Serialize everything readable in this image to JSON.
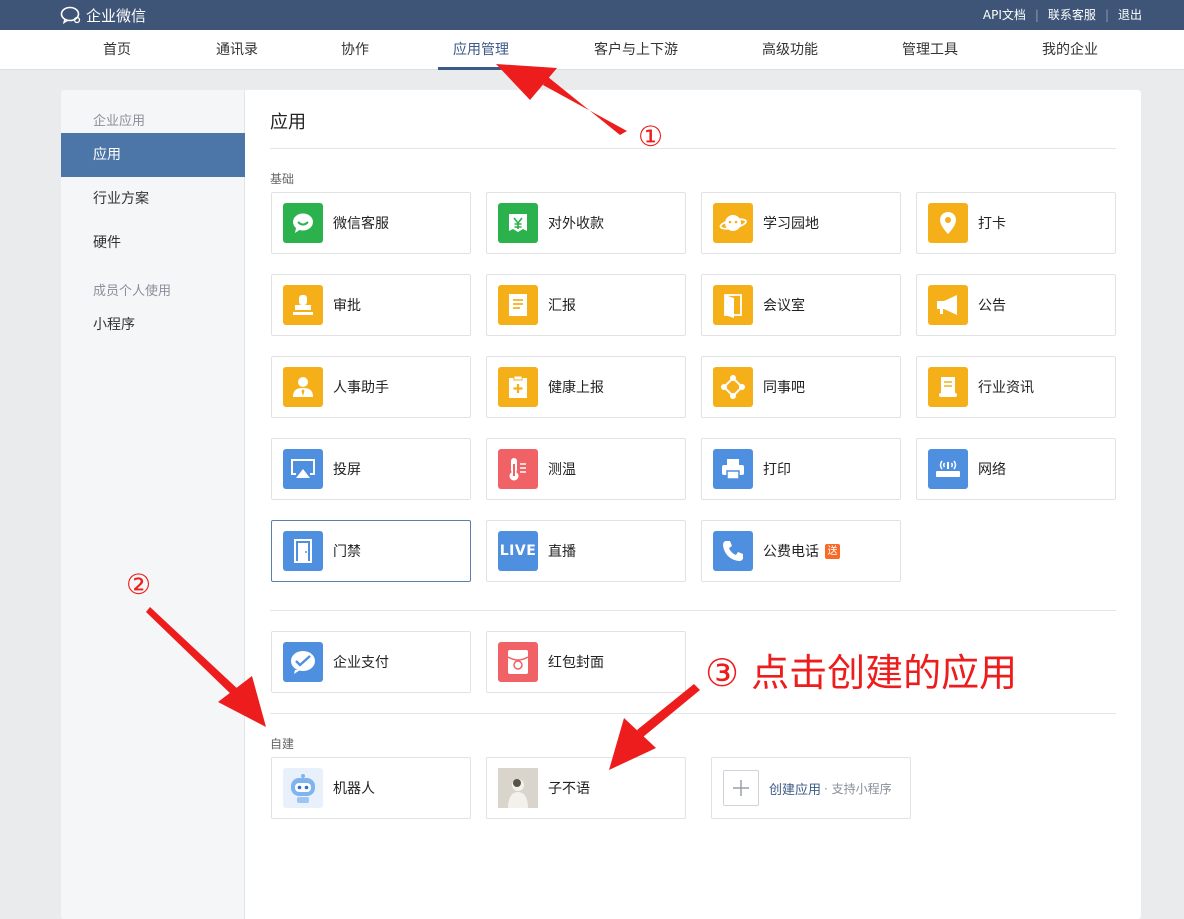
{
  "header": {
    "brand": "企业微信",
    "links": [
      "API文档",
      "联系客服",
      "退出"
    ]
  },
  "nav": {
    "items": [
      "首页",
      "通讯录",
      "协作",
      "应用管理",
      "客户与上下游",
      "高级功能",
      "管理工具",
      "我的企业"
    ],
    "active": "应用管理"
  },
  "sidebar": {
    "group1": "企业应用",
    "items1": [
      "应用",
      "行业方案",
      "硬件"
    ],
    "active": "应用",
    "group2": "成员个人使用",
    "items2": [
      "小程序"
    ]
  },
  "main": {
    "title": "应用",
    "section_basic": "基础",
    "basic_apps": [
      {
        "label": "微信客服",
        "icon": "chat-bubble-icon",
        "color": "#2bb24c"
      },
      {
        "label": "对外收款",
        "icon": "yuan-icon",
        "color": "#2bb24c"
      },
      {
        "label": "学习园地",
        "icon": "planet-icon",
        "color": "#f5b019"
      },
      {
        "label": "打卡",
        "icon": "location-pin-icon",
        "color": "#f5b019"
      },
      {
        "label": "审批",
        "icon": "stamp-icon",
        "color": "#f5b019"
      },
      {
        "label": "汇报",
        "icon": "report-doc-icon",
        "color": "#f5b019"
      },
      {
        "label": "会议室",
        "icon": "door-icon",
        "color": "#f5b019"
      },
      {
        "label": "公告",
        "icon": "megaphone-icon",
        "color": "#f5b019"
      },
      {
        "label": "人事助手",
        "icon": "person-icon",
        "color": "#f5b019"
      },
      {
        "label": "健康上报",
        "icon": "health-clipboard-icon",
        "color": "#f5b019"
      },
      {
        "label": "同事吧",
        "icon": "network-icon",
        "color": "#f5b019"
      },
      {
        "label": "行业资讯",
        "icon": "scroll-icon",
        "color": "#f5b019"
      },
      {
        "label": "投屏",
        "icon": "airplay-icon",
        "color": "#4f8fe0"
      },
      {
        "label": "测温",
        "icon": "thermometer-icon",
        "color": "#f06266"
      },
      {
        "label": "打印",
        "icon": "printer-icon",
        "color": "#4f8fe0"
      },
      {
        "label": "网络",
        "icon": "router-icon",
        "color": "#4f8fe0"
      },
      {
        "label": "门禁",
        "icon": "access-door-icon",
        "color": "#4f8fe0"
      },
      {
        "label": "直播",
        "icon": "live-icon",
        "color": "#4f8fe0"
      },
      {
        "label": "公费电话",
        "icon": "phone-icon",
        "color": "#4f8fe0",
        "badge": "送"
      }
    ],
    "pay_apps": [
      {
        "label": "企业支付",
        "icon": "wepay-icon",
        "color": "#4f8fe0"
      },
      {
        "label": "红包封面",
        "icon": "red-envelope-icon",
        "color": "#f06266"
      }
    ],
    "section_custom": "自建",
    "custom_apps": [
      {
        "label": "机器人",
        "icon": "robot-icon"
      },
      {
        "label": "子不语",
        "icon": "custom-app-icon"
      }
    ],
    "create_label": "创建应用",
    "create_sub": "· 支持小程序"
  },
  "annotations": {
    "n1": "①",
    "n2": "②",
    "n3": "③ 点击创建的应用"
  }
}
